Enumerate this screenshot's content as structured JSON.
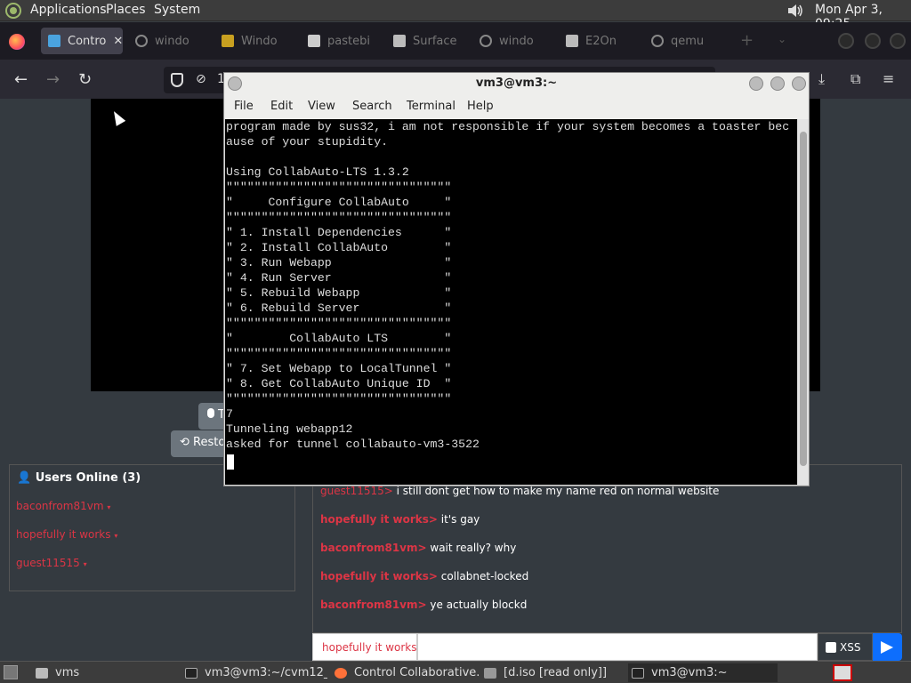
{
  "top_panel": {
    "menus": [
      "Applications",
      "Places",
      "System"
    ],
    "clock": "Mon Apr  3, 09:25"
  },
  "browser": {
    "tabs": [
      {
        "label": "Contro",
        "icon": "monitor-icon",
        "active": true
      },
      {
        "label": "windo",
        "icon": "google-icon"
      },
      {
        "label": "Windo",
        "icon": "favicon-icon"
      },
      {
        "label": "pastebi",
        "icon": "pastebin-icon"
      },
      {
        "label": "Surface",
        "icon": "columns-icon"
      },
      {
        "label": "windo",
        "icon": "google-icon"
      },
      {
        "label": "E2On",
        "icon": "columns-icon"
      },
      {
        "label": "qemu",
        "icon": "google-icon"
      }
    ],
    "url_fragment": "1"
  },
  "page": {
    "take_turn_label": "T",
    "restore_label": "Resto",
    "users": {
      "title": "Users Online (3)",
      "list": [
        "baconfrom81vm",
        "hopefully it works",
        "guest11515"
      ]
    },
    "chat": {
      "messages": [
        {
          "user": "guest11515>",
          "text": "i still dont get how to make my name red on normal website"
        },
        {
          "user": "hopefully it works>",
          "text": "it's gay"
        },
        {
          "user": "baconfrom81vm>",
          "text": "wait really? why"
        },
        {
          "user": "hopefully it works>",
          "text": "collabnet-locked"
        },
        {
          "user": "baconfrom81vm>",
          "text": "ye actually blockd"
        }
      ],
      "name": "hopefully it works",
      "xss_label": "XSS"
    }
  },
  "terminal": {
    "title": "vm3@vm3:~",
    "menu": [
      "File",
      "Edit",
      "View",
      "Search",
      "Terminal",
      "Help"
    ],
    "output": "program made by sus32, i am not responsible if your system becomes a toaster bec\nause of your stupidity.\n\nUsing CollabAuto-LTS 1.3.2\n\"\"\"\"\"\"\"\"\"\"\"\"\"\"\"\"\"\"\"\"\"\"\"\"\"\"\"\"\"\"\"\"\n\"     Configure CollabAuto     \"\n\"\"\"\"\"\"\"\"\"\"\"\"\"\"\"\"\"\"\"\"\"\"\"\"\"\"\"\"\"\"\"\"\n\" 1. Install Dependencies      \"\n\" 2. Install CollabAuto        \"\n\" 3. Run Webapp                \"\n\" 4. Run Server                \"\n\" 5. Rebuild Webapp            \"\n\" 6. Rebuild Server            \"\n\"\"\"\"\"\"\"\"\"\"\"\"\"\"\"\"\"\"\"\"\"\"\"\"\"\"\"\"\"\"\"\"\n\"        CollabAuto LTS        \"\n\"\"\"\"\"\"\"\"\"\"\"\"\"\"\"\"\"\"\"\"\"\"\"\"\"\"\"\"\"\"\"\"\n\" 7. Set Webapp to LocalTunnel \"\n\" 8. Get CollabAuto Unique ID  \"\n\"\"\"\"\"\"\"\"\"\"\"\"\"\"\"\"\"\"\"\"\"\"\"\"\"\"\"\"\"\"\"\"\n7\nTunneling webapp12\nasked for tunnel collabauto-vm3-3522"
  },
  "taskbar": {
    "items": [
      "vms",
      "vm3@vm3:~/cvm12_2",
      "Control Collaborative...",
      "[d.iso [read only]]",
      "vm3@vm3:~"
    ]
  }
}
